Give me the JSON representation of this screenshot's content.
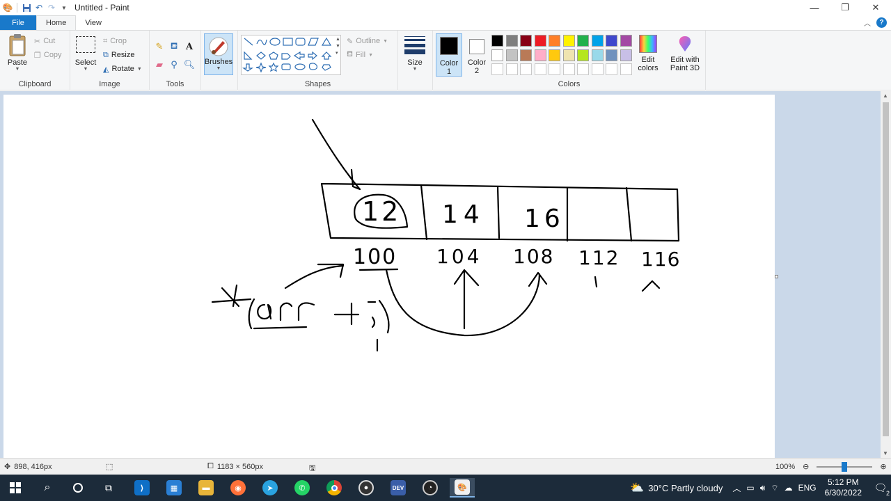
{
  "window": {
    "title": "Untitled - Paint"
  },
  "tabs": {
    "file": "File",
    "home": "Home",
    "view": "View"
  },
  "clipboard": {
    "paste": "Paste",
    "cut": "Cut",
    "copy": "Copy",
    "label": "Clipboard"
  },
  "image": {
    "select": "Select",
    "crop": "Crop",
    "resize": "Resize",
    "rotate": "Rotate",
    "label": "Image"
  },
  "tools": {
    "label": "Tools"
  },
  "brushes": {
    "label": "Brushes"
  },
  "shapes": {
    "outline": "Outline",
    "fill": "Fill",
    "label": "Shapes"
  },
  "size": {
    "label": "Size"
  },
  "colors": {
    "color1": "Color",
    "color1_num": "1",
    "color2": "Color",
    "color2_num": "2",
    "edit_colors_1": "Edit",
    "edit_colors_2": "colors",
    "paint3d_1": "Edit with",
    "paint3d_2": "Paint 3D",
    "label": "Colors",
    "palette_row1": [
      "#000000",
      "#7f7f7f",
      "#880015",
      "#ed1c24",
      "#ff7f27",
      "#fff200",
      "#22b14c",
      "#00a2e8",
      "#3f48cc",
      "#a349a4"
    ],
    "palette_row2": [
      "#ffffff",
      "#c3c3c3",
      "#b97a57",
      "#ffaec9",
      "#ffc90e",
      "#efe4b0",
      "#b5e61d",
      "#99d9ea",
      "#7092be",
      "#c8bfe7"
    ]
  },
  "status": {
    "cursor_pos": "898, 416px",
    "canvas_size": "1183 × 560px",
    "zoom": "100%"
  },
  "canvas_drawing": {
    "cells": [
      "12",
      "14",
      "16"
    ],
    "addresses": [
      "100",
      "104",
      "108",
      "112",
      "116"
    ]
  },
  "taskbar": {
    "weather": "30°C  Partly cloudy",
    "lang": "ENG",
    "time": "5:12 PM",
    "date": "6/30/2022",
    "notif_count": "2"
  }
}
